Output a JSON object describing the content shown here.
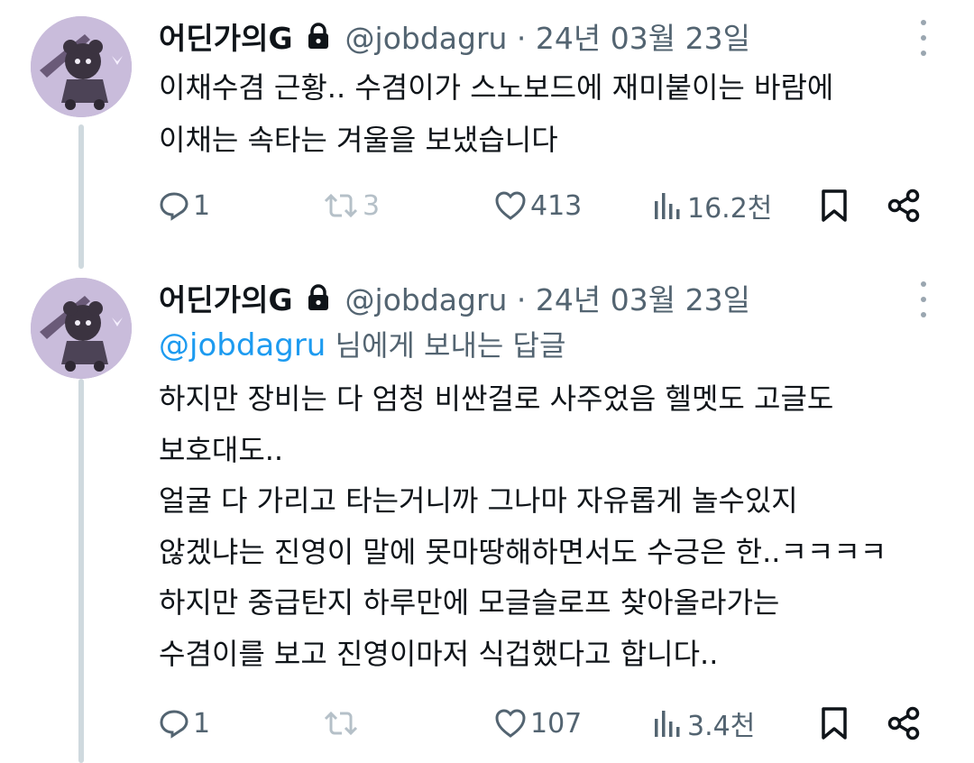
{
  "tweets": [
    {
      "author_name": "어딘가의G",
      "handle_meta": "@jobdagru · 24년 03월 23일",
      "text": "이채수겸 근황.. 수겸이가 스노보드에 재미붙이는 바람에\n이채는 속타는 겨울을 보냈습니다",
      "replies": "1",
      "retweets": "3",
      "likes": "413",
      "views": "16.2천"
    },
    {
      "author_name": "어딘가의G",
      "handle_meta": "@jobdagru · 24년 03월 23일",
      "reply_to_mention": "@jobdagru",
      "reply_to_suffix": " 님에게 보내는 답글",
      "text": "하지만 장비는 다 엄청 비싼걸로 사주었음 헬멧도 고글도\n보호대도..\n얼굴 다 가리고 타는거니까 그나마 자유롭게 놀수있지\n않겠냐는 진영이 말에 못마땅해하면서도 수긍은 한..ㅋㅋㅋㅋ\n하지만 중급탄지 하루만에 모글슬로프 찾아올라가는\n수겸이를 보고 진영이마저 식겁했다고 합니다..",
      "replies": "1",
      "retweets": "",
      "likes": "107",
      "views": "3.4천"
    }
  ],
  "icons": [
    "avatar",
    "lock-icon",
    "more-icon",
    "reply-icon",
    "retweet-icon",
    "like-icon",
    "views-icon",
    "bookmark-icon",
    "share-icon"
  ],
  "colors": {
    "text": "#0f1419",
    "secondary": "#536471",
    "link": "#1d9bf0",
    "thread_line": "#cfd9de"
  }
}
